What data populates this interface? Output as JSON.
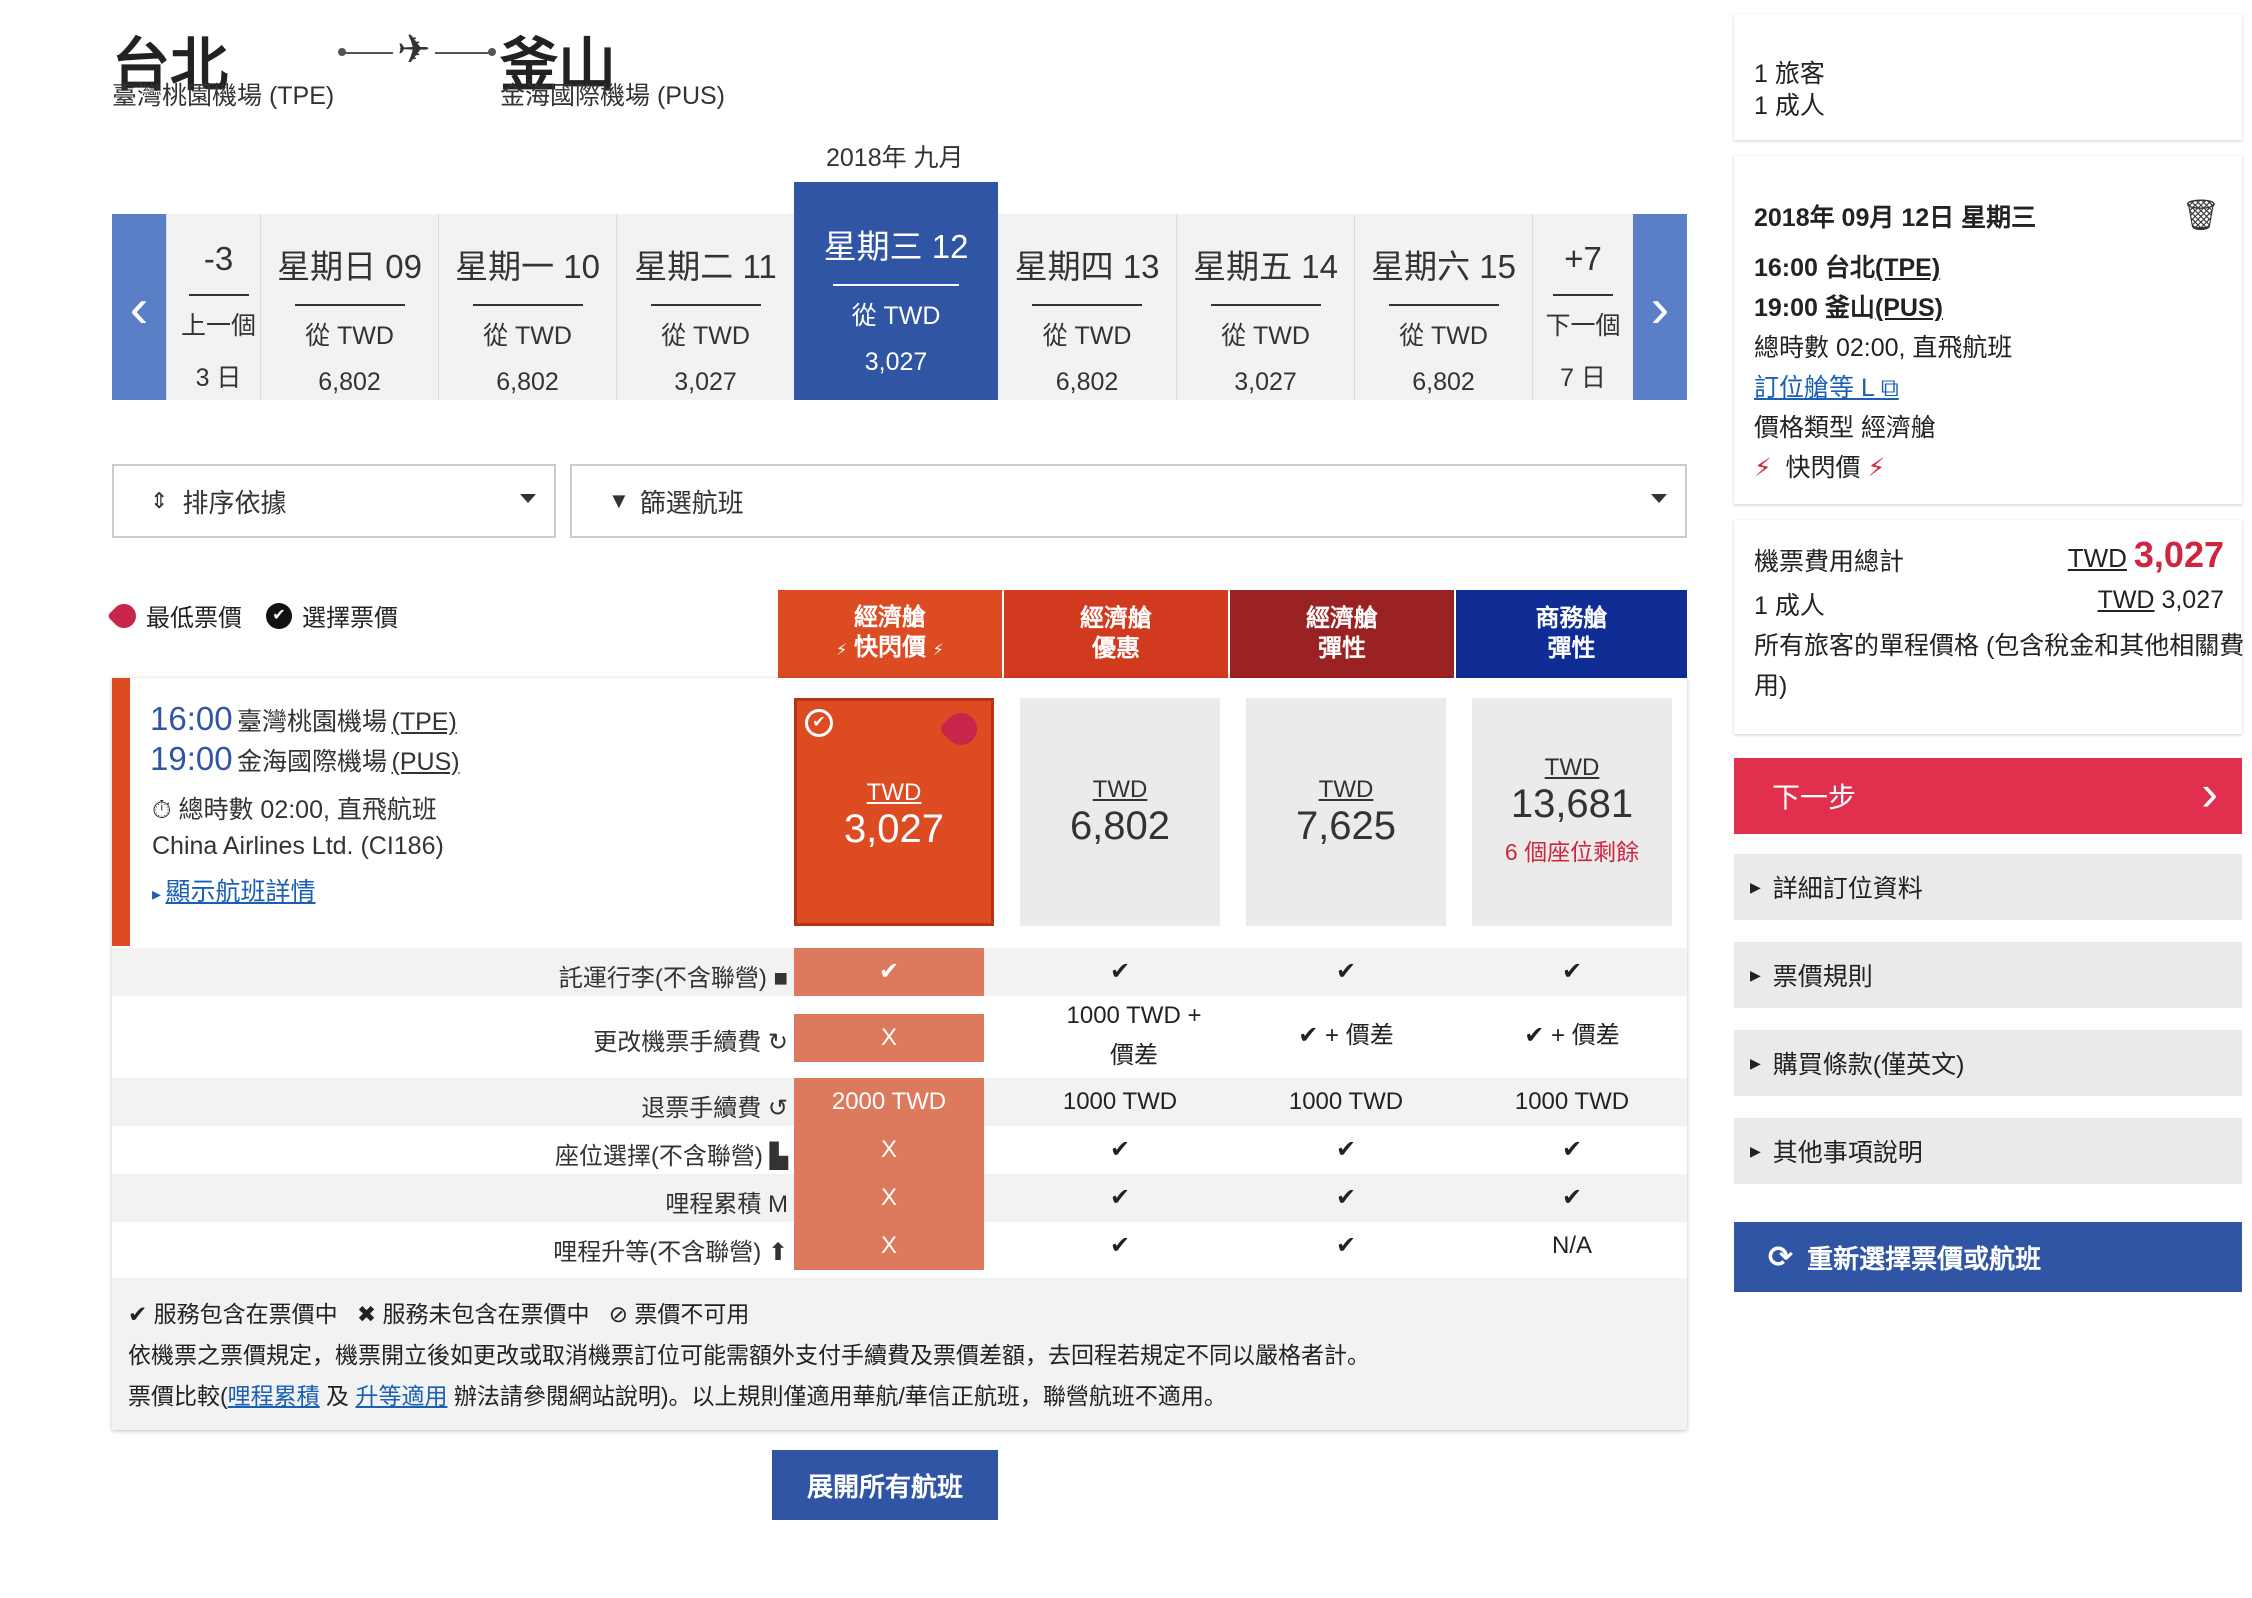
{
  "route": {
    "origin_city": "台北",
    "origin_airport": "臺灣桃園機場 (TPE)",
    "dest_city": "釜山",
    "dest_airport": "金海國際機場 (PUS)",
    "plane_icon": "airplane-icon"
  },
  "calendar": {
    "month": "2018年 九月",
    "prev": {
      "label": "-3",
      "sub1": "上一個",
      "sub2": "3 日"
    },
    "next": {
      "label": "+7",
      "sub1": "下一個",
      "sub2": "7 日"
    },
    "days": [
      {
        "label": "星期日 09",
        "from": "從 TWD",
        "price": "6,802"
      },
      {
        "label": "星期一 10",
        "from": "從 TWD",
        "price": "6,802"
      },
      {
        "label": "星期二 11",
        "from": "從 TWD",
        "price": "3,027"
      },
      {
        "label": "星期三 12",
        "from": "從 TWD",
        "price": "3,027"
      },
      {
        "label": "星期四 13",
        "from": "從 TWD",
        "price": "6,802"
      },
      {
        "label": "星期五 14",
        "from": "從 TWD",
        "price": "3,027"
      },
      {
        "label": "星期六 15",
        "from": "從 TWD",
        "price": "6,802"
      }
    ]
  },
  "controls": {
    "sort_label": "排序依據",
    "filter_label": "篩選航班"
  },
  "legend": {
    "lowest": "最低票價",
    "selected": "選擇票價"
  },
  "fare_types": [
    {
      "line1": "經濟艙",
      "line2": "快閃價",
      "color": "#dd4b23",
      "flash": "⚡"
    },
    {
      "line1": "經濟艙",
      "line2": "優惠",
      "color": "#d23a1f"
    },
    {
      "line1": "經濟艙",
      "line2": "彈性",
      "color": "#9b2222"
    },
    {
      "line1": "商務艙",
      "line2": "彈性",
      "color": "#0f2d94"
    }
  ],
  "flight": {
    "dep_time": "16:00",
    "dep_airport": "臺灣桃園機場",
    "dep_code": "(TPE)",
    "arr_time": "19:00",
    "arr_airport": "金海國際機場",
    "arr_code": "(PUS)",
    "duration": "總時數 02:00, 直飛航班",
    "carrier": "China Airlines Ltd. (CI186)",
    "details_link": "顯示航班詳情",
    "fares": [
      {
        "currency": "TWD",
        "amount": "3,027"
      },
      {
        "currency": "TWD",
        "amount": "6,802"
      },
      {
        "currency": "TWD",
        "amount": "7,625"
      },
      {
        "currency": "TWD",
        "amount": "13,681",
        "seats": "6 個座位剩餘"
      }
    ]
  },
  "features": [
    {
      "label": "託運行李(不含聯營)",
      "icon": "suitcase-icon",
      "glyph": "■",
      "values": [
        "✔",
        "✔",
        "✔",
        "✔"
      ]
    },
    {
      "label": "更改機票手續費",
      "icon": "refresh-icon",
      "glyph": "↻",
      "values": [
        "X",
        "1000 TWD + 價差",
        "✔ + 價差",
        "✔ + 價差"
      ]
    },
    {
      "label": "退票手續費",
      "icon": "refund-icon",
      "glyph": "↺",
      "values": [
        "2000 TWD",
        "1000 TWD",
        "1000 TWD",
        "1000 TWD"
      ]
    },
    {
      "label": "座位選擇(不含聯營)",
      "icon": "seat-icon",
      "glyph": "▙",
      "values": [
        "X",
        "✔",
        "✔",
        "✔"
      ]
    },
    {
      "label": "哩程累積",
      "icon": "miles-icon",
      "glyph": "M",
      "values": [
        "X",
        "✔",
        "✔",
        "✔"
      ]
    },
    {
      "label": "哩程升等(不含聯營)",
      "icon": "upgrade-icon",
      "glyph": "⬆",
      "values": [
        "X",
        "✔",
        "✔",
        "N/A"
      ]
    }
  ],
  "notes": {
    "legend_included": "服務包含在票價中",
    "legend_excluded": "服務未包含在票價中",
    "legend_unavailable": "票價不可用",
    "line2": "依機票之票價規定，機票開立後如更改或取消機票訂位可能需額外支付手續費及票價差額，去回程若規定不同以嚴格者計。",
    "line3_pre": "票價比較(",
    "link_miles": "哩程累積",
    "line3_mid": " 及 ",
    "link_upgrade": "升等適用",
    "line3_post": " 辦法請參閱網站說明)。以上規則僅適用華航/華信正航班，聯營航班不適用。"
  },
  "expand_label": "展開所有航班",
  "sidebar": {
    "pax_line1": "1 旅客",
    "pax_line2": "1 成人",
    "date": "2018年 09月 12日 星期三",
    "dep": "16:00 台北",
    "dep_code": "(TPE)",
    "arr": "19:00 釜山",
    "arr_code": "(PUS)",
    "duration": "總時數 02:00, 直飛航班",
    "booking_class": "訂位艙等 L",
    "fare_type": "價格類型 經濟艙",
    "flash_label": "快閃價",
    "total_label": "機票費用總計",
    "total_currency": "TWD",
    "total_amount": "3,027",
    "adult_label": "1 成人",
    "adult_currency": "TWD",
    "adult_amount": "3,027",
    "tax_note_1": "所有旅客的單程價格 (包含稅金和其他相關費",
    "tax_note_2": "用)",
    "next_label": "下一步",
    "accordion": [
      "詳細訂位資料",
      "票價規則",
      "購買條款(僅英文)",
      "其他事項說明"
    ],
    "reselect_label": "重新選擇票價或航班"
  }
}
